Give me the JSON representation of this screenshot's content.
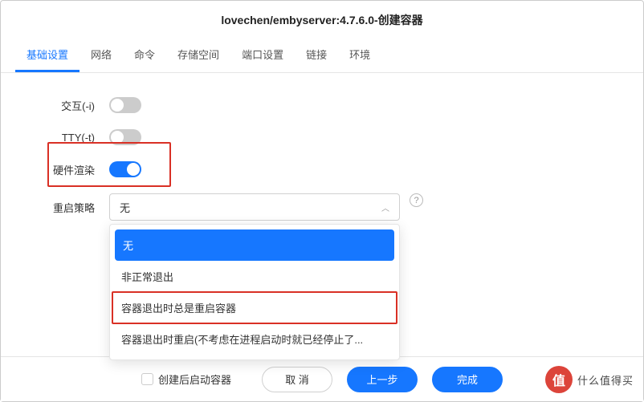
{
  "header": {
    "title": "lovechen/embyserver:4.7.6.0-创建容器"
  },
  "tabs": [
    {
      "label": "基础设置",
      "active": true
    },
    {
      "label": "网络"
    },
    {
      "label": "命令"
    },
    {
      "label": "存储空间"
    },
    {
      "label": "端口设置"
    },
    {
      "label": "链接"
    },
    {
      "label": "环境"
    }
  ],
  "form": {
    "interactive_label": "交互(-i)",
    "tty_label": "TTY(-t)",
    "hwrender_label": "硬件渲染",
    "restart_label": "重启策略",
    "restart_value": "无",
    "help_icon": "?"
  },
  "restart_options": [
    {
      "label": "无",
      "selected": true
    },
    {
      "label": "非正常退出"
    },
    {
      "label": "容器退出时总是重启容器",
      "highlight": true
    },
    {
      "label": "容器退出时重启(不考虑在进程启动时就已经停止了..."
    }
  ],
  "footer": {
    "autostart_label": "创建后启动容器",
    "cancel": "取 消",
    "prev": "上一步",
    "done": "完成"
  },
  "watermark": {
    "badge": "值",
    "text": "什么值得买"
  }
}
